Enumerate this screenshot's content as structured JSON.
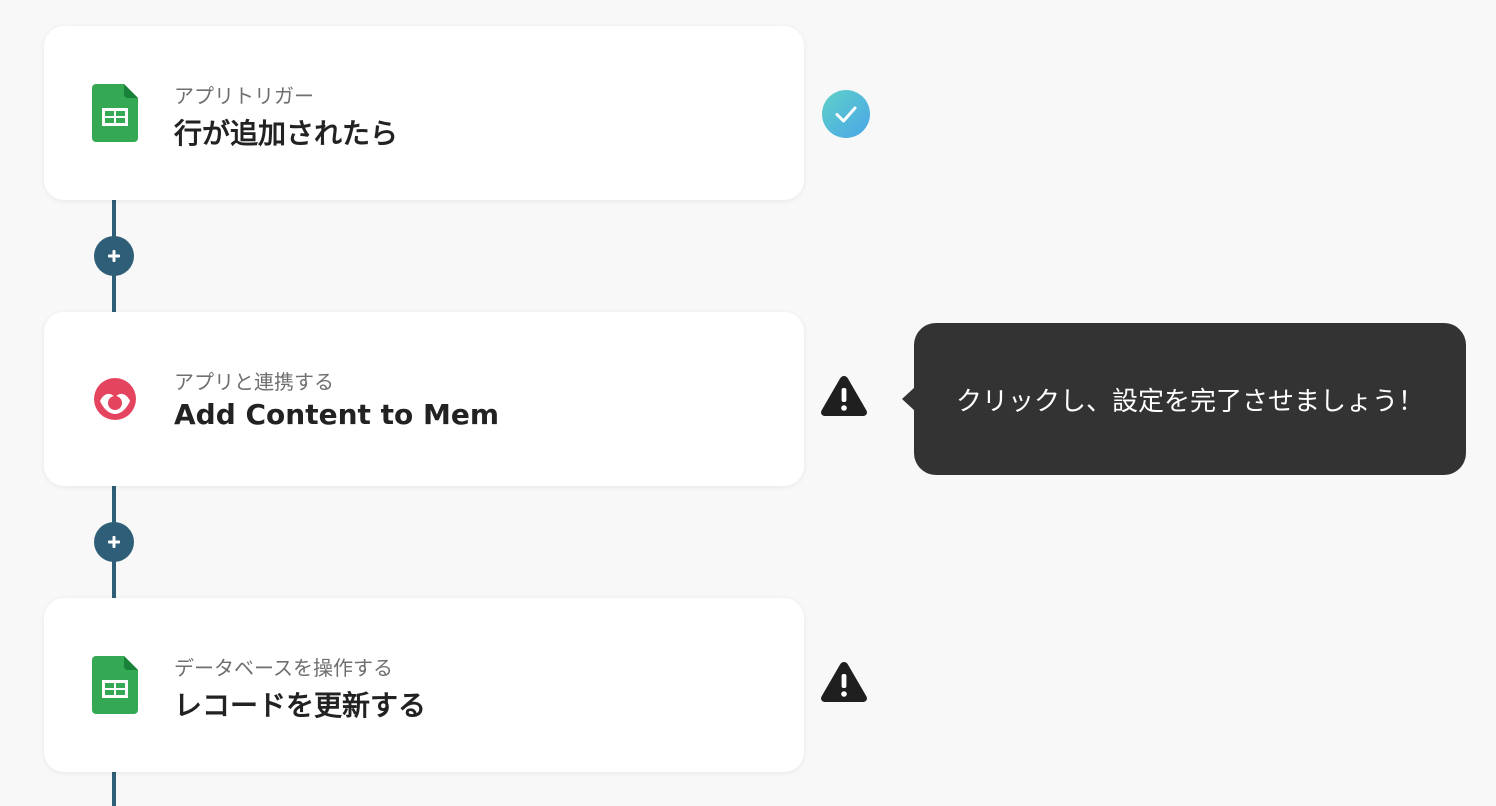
{
  "steps": [
    {
      "label": "アプリトリガー",
      "title": "行が追加されたら",
      "icon": "google-sheets-icon",
      "status": "complete"
    },
    {
      "label": "アプリと連携する",
      "title": "Add Content to Mem",
      "icon": "mem-icon",
      "status": "warning"
    },
    {
      "label": "データベースを操作する",
      "title": "レコードを更新する",
      "icon": "google-sheets-icon",
      "status": "warning"
    }
  ],
  "tooltip": {
    "text": "クリックし、設定を完了させましょう！"
  },
  "colors": {
    "connector": "#2f5f78",
    "check_start": "#5fd0c8",
    "check_end": "#4aa6e8",
    "warning": "#1f1f1f",
    "sheets_green": "#34a853",
    "mem_pink": "#e5445e",
    "tooltip_bg": "#333333"
  }
}
